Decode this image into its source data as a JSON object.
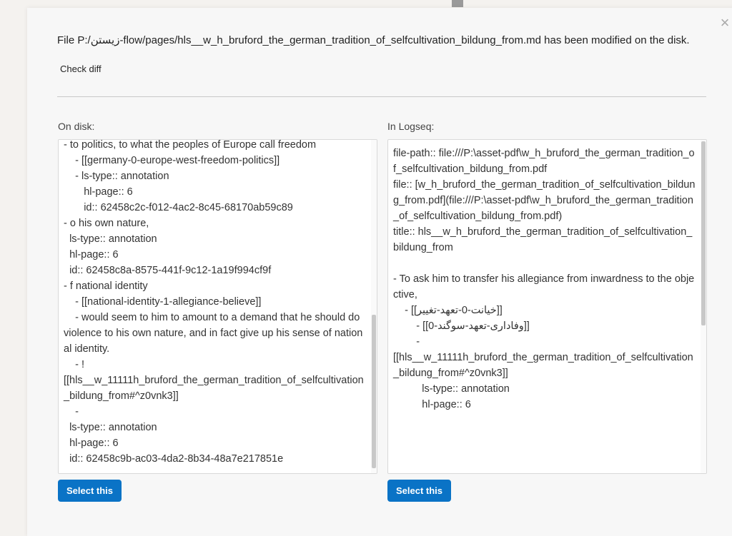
{
  "dialog": {
    "message": "File P:/زیستن-flow/pages/hls__w_h_bruford_the_german_tradition_of_selfcultivation_bildung_from.md has been modified on the disk.",
    "check_diff_label": "Check diff",
    "close_icon": "close-icon"
  },
  "on_disk": {
    "label": "On disk:",
    "content": "- to politics, to what the peoples of Europe call freedom\n    - [[germany-0-europe-west-freedom-politics]]\n    - ls-type:: annotation\n       hl-page:: 6\n       id:: 62458c2c-f012-4ac2-8c45-68170ab59c89\n- o his own nature,\n  ls-type:: annotation\n  hl-page:: 6\n  id:: 62458c8a-8575-441f-9c12-1a19f994cf9f\n- f national identity\n    - [[national-identity-1-allegiance-believe]]\n    - would seem to him to amount to a demand that he should do violence to his own nature, and in fact give up his sense of national identity.\n    - !\n[[hls__w_11111h_bruford_the_german_tradition_of_selfcultivation_bildung_from#^z0vnk3]]\n    -\n  ls-type:: annotation\n  hl-page:: 6\n  id:: 62458c9b-ac03-4da2-8b34-48a7e217851e",
    "select_label": "Select this"
  },
  "in_logseq": {
    "label": "In Logseq:",
    "content": "file-path:: file:///P:\\asset-pdf\\w_h_bruford_the_german_tradition_of_selfcultivation_bildung_from.pdf\nfile:: [w_h_bruford_the_german_tradition_of_selfcultivation_bildung_from.pdf](file:///P:\\asset-pdf\\w_h_bruford_the_german_tradition_of_selfcultivation_bildung_from.pdf)\ntitle:: hls__w_h_bruford_the_german_tradition_of_selfcultivation_bildung_from\n\n- To ask him to transfer his allegiance from inwardness to the objective,\n    - [[خیانت-0-تعهد-تغییر]]\n        - [[وفاداری-تعهد-سوگند-0]]\n        -\n[[hls__w_11111h_bruford_the_german_tradition_of_selfcultivation_bildung_from#^z0vnk3]]\n          ls-type:: annotation\n          hl-page:: 6",
    "select_label": "Select this"
  }
}
